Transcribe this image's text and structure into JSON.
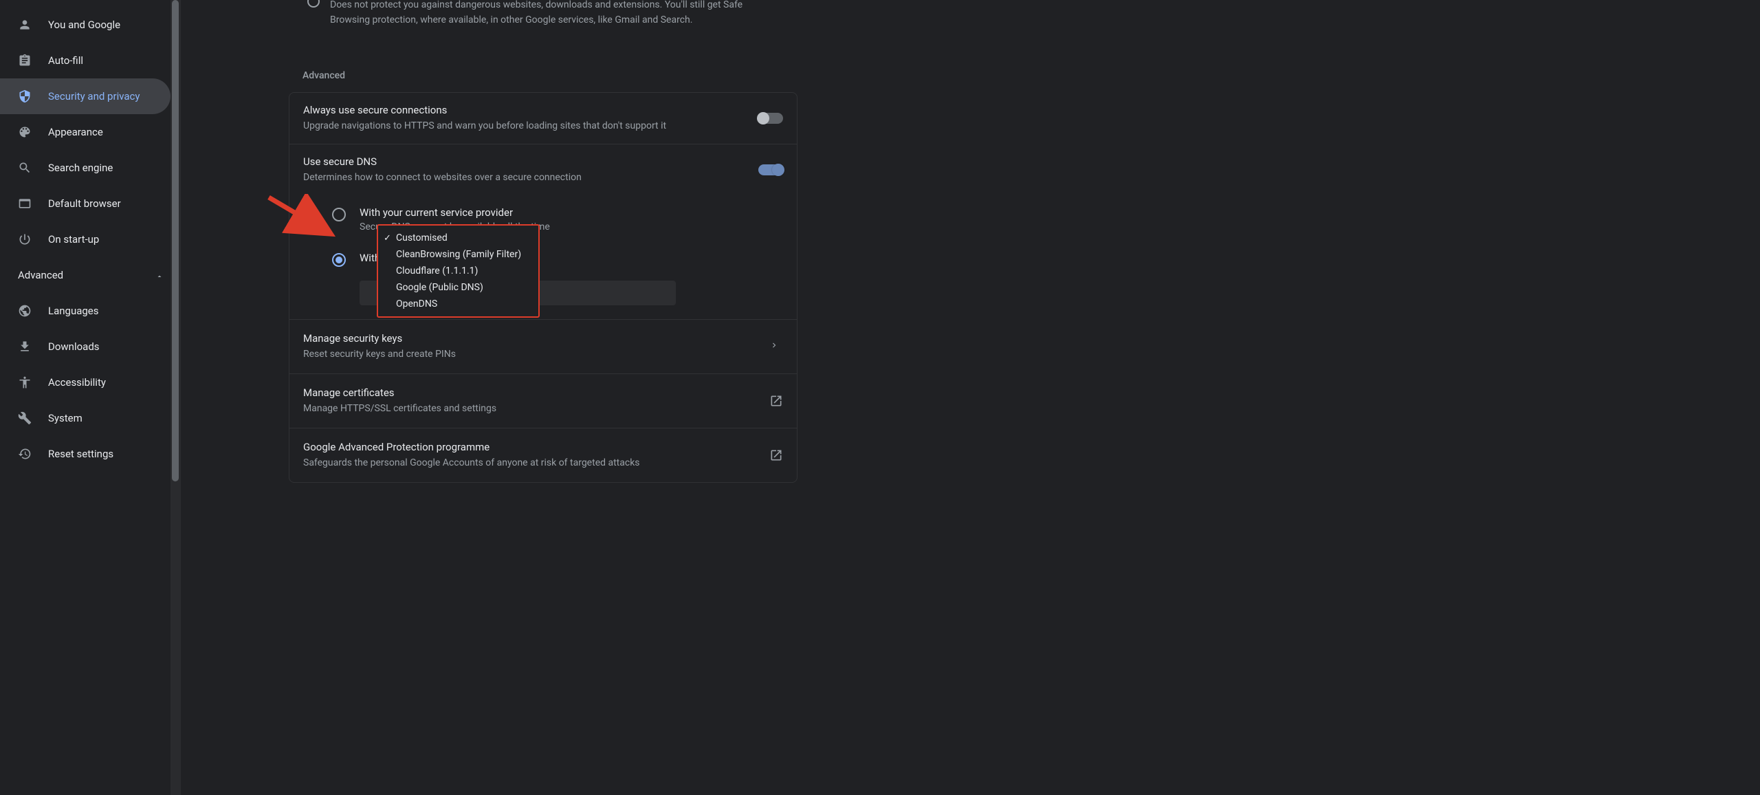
{
  "sidebar": {
    "items": [
      {
        "label": "You and Google"
      },
      {
        "label": "Auto-fill"
      },
      {
        "label": "Security and privacy"
      },
      {
        "label": "Appearance"
      },
      {
        "label": "Search engine"
      },
      {
        "label": "Default browser"
      },
      {
        "label": "On start-up"
      }
    ],
    "advanced_label": "Advanced",
    "advanced_items": [
      {
        "label": "Languages"
      },
      {
        "label": "Downloads"
      },
      {
        "label": "Accessibility"
      },
      {
        "label": "System"
      },
      {
        "label": "Reset settings"
      }
    ]
  },
  "content": {
    "partial_option_desc": "Does not protect you against dangerous websites, downloads and extensions. You'll still get Safe Browsing protection, where available, in other Google services, like Gmail and Search.",
    "advanced_section": "Advanced",
    "secure_connections": {
      "title": "Always use secure connections",
      "desc": "Upgrade navigations to HTTPS and warn you before loading sites that don't support it"
    },
    "secure_dns": {
      "title": "Use secure DNS",
      "desc": "Determines how to connect to websites over a secure connection",
      "option1_title": "With your current service provider",
      "option1_desc": "Secure DNS may not be available all the time",
      "option2_title": "With"
    },
    "dropdown": {
      "options": [
        "Customised",
        "CleanBrowsing (Family Filter)",
        "Cloudflare (1.1.1.1)",
        "Google (Public DNS)",
        "OpenDNS"
      ]
    },
    "links": [
      {
        "title": "Manage security keys",
        "desc": "Reset security keys and create PINs"
      },
      {
        "title": "Manage certificates",
        "desc": "Manage HTTPS/SSL certificates and settings"
      },
      {
        "title": "Google Advanced Protection programme",
        "desc": "Safeguards the personal Google Accounts of anyone at risk of targeted attacks"
      }
    ]
  }
}
